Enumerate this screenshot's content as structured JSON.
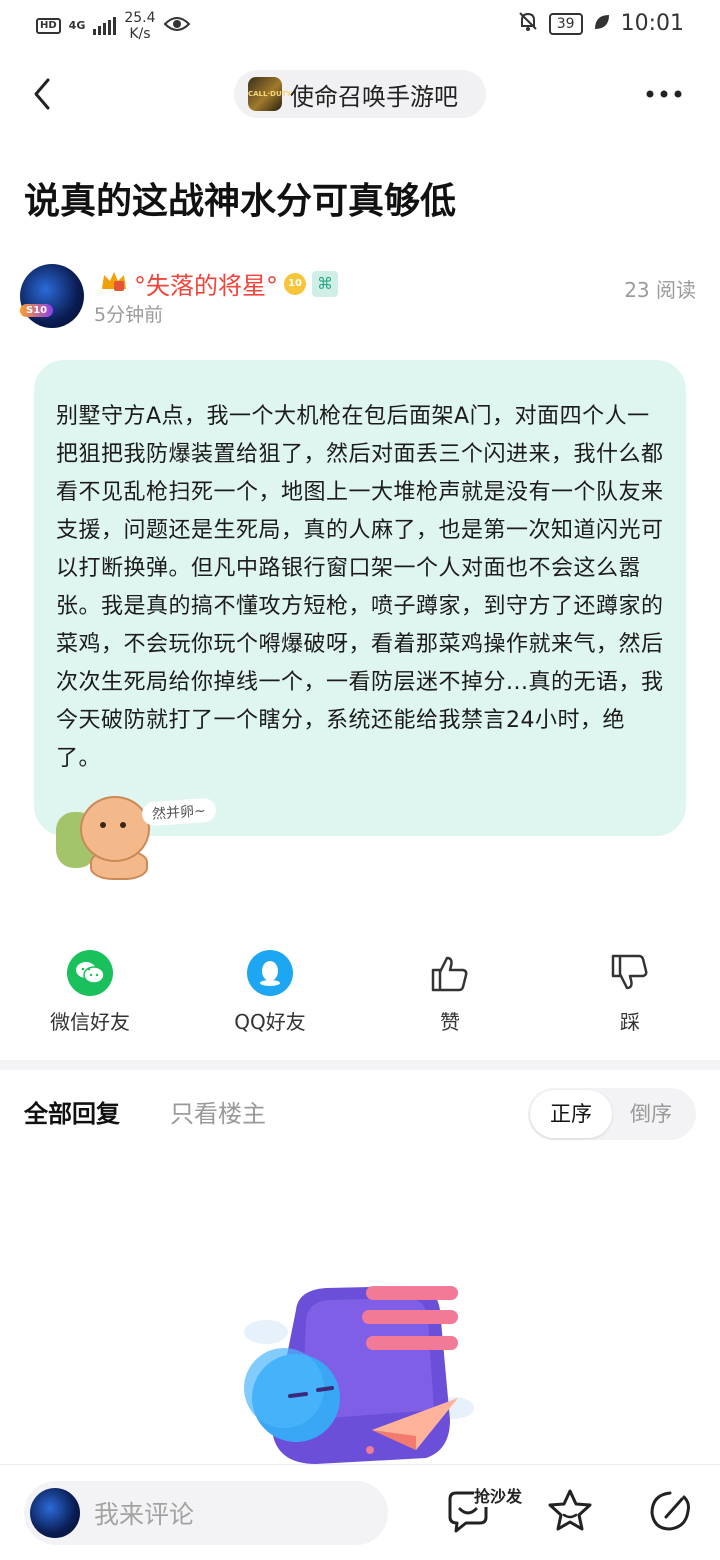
{
  "status_bar": {
    "hd": "HD",
    "network": "4G",
    "speed_value": "25.4",
    "speed_unit": "K/s",
    "battery": "39",
    "time": "10:01"
  },
  "nav": {
    "forum_name": "使命召唤手游吧",
    "forum_avatar_text": "CALL·DUTY"
  },
  "post": {
    "title": "说真的这战神水分可真够低",
    "author_name": "°失落的将星°",
    "level_badge": "10",
    "avatar_badge": "S10",
    "time_ago": "5分钟前",
    "read_count": "23 阅读",
    "body": "别墅守方A点，我一个大机枪在包后面架A门，对面四个人一把狙把我防爆装置给狙了，然后对面丢三个闪进来，我什么都看不见乱枪扫死一个，地图上一大堆枪声就是没有一个队友来支援，问题还是生死局，真的人麻了，也是第一次知道闪光可以打断换弹。但凡中路银行窗口架一个人对面也不会这么嚣张。我是真的搞不懂攻方短枪，喷子蹲家，到守方了还蹲家的菜鸡，不会玩你玩个嘚爆破呀，看着那菜鸡操作就来气，然后次次生死局给你掉线一个，一看防层迷不掉分...真的无语，我今天破防就打了一个瞎分，系统还能给我禁言24小时，绝了。",
    "sticker_text": "然并卵~"
  },
  "share": {
    "wechat": "微信好友",
    "qq": "QQ好友",
    "like": "赞",
    "dislike": "踩"
  },
  "replies": {
    "tab_all": "全部回复",
    "tab_owner": "只看楼主",
    "order_asc": "正序",
    "order_desc": "倒序"
  },
  "bottom": {
    "comment_placeholder": "我来评论",
    "sofa_label": "抢沙发"
  },
  "colors": {
    "bubble_bg": "#dff5f0",
    "author_name": "#f2443a",
    "wechat_green": "#19c05c",
    "qq_blue": "#1da6f2"
  }
}
